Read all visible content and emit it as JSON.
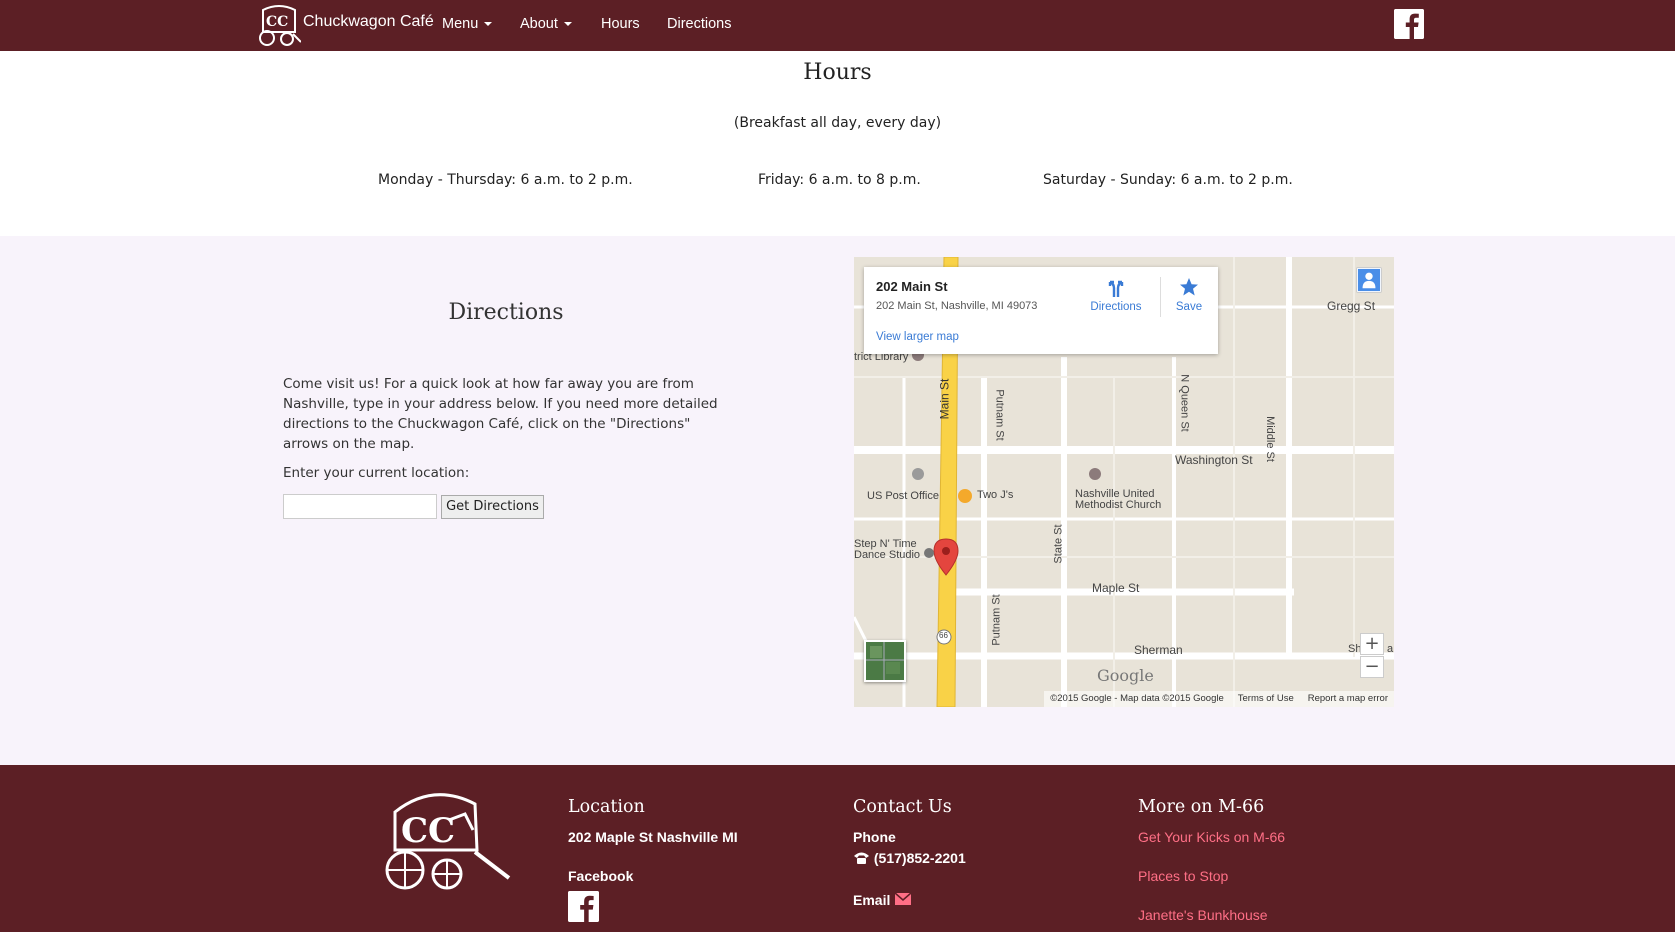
{
  "navbar": {
    "brand": "Chuckwagon Café",
    "items": [
      {
        "label": "Menu",
        "dropdown": true
      },
      {
        "label": "About",
        "dropdown": true
      },
      {
        "label": "Hours",
        "dropdown": false
      },
      {
        "label": "Directions",
        "dropdown": false
      }
    ],
    "colors": {
      "background": "#5c1f25",
      "text": "#ffffff"
    }
  },
  "hours": {
    "title": "Hours",
    "subtitle": "(Breakfast all day, every day)",
    "schedule": [
      "Monday - Thursday: 6 a.m. to 2 p.m.",
      "Friday: 6 a.m. to 8 p.m.",
      "Saturday - Sunday: 6 a.m. to 2 p.m."
    ]
  },
  "directions": {
    "title": "Directions",
    "intro": "Come visit us! For a quick look at how far away you are from Nashville, type in your address below. If you need more detailed directions to the Chuckwagon Café, click on the \"Directions\" arrows on the map.",
    "input_label": "Enter your current location:",
    "input_value": "",
    "button_label": "Get Directions",
    "background": "#f8f3fb"
  },
  "map": {
    "card": {
      "title": "202 Main St",
      "address": "202 Main St, Nashville, MI 49073",
      "larger_map": "View larger map",
      "directions": "Directions",
      "save": "Save"
    },
    "labels": {
      "gregg": "Gregg St",
      "library": "trict Library",
      "main": "Main St",
      "putnam_top": "Putnam St",
      "queen": "N Queen St",
      "middle": "Middle St",
      "washington": "Washington St",
      "post_office": "US Post Office",
      "two_js": "Two J's",
      "church1": "Nashville United",
      "church2": "Methodist Church",
      "step1": "Step N' Time",
      "step2": "Dance Studio",
      "state": "State St",
      "maple": "Maple St",
      "putnam_bottom": "Putnam St",
      "sherman": "Sherman",
      "sh_right": "Sh",
      "a_right": "a",
      "route": "66"
    },
    "google": "Google",
    "zoom_in": "+",
    "zoom_out": "−",
    "footer": {
      "copyright": "©2015 Google - Map data ©2015 Google",
      "terms": "Terms of Use",
      "report": "Report a map error"
    }
  },
  "footer": {
    "location": {
      "heading": "Location",
      "address": "202 Maple St Nashville MI",
      "facebook": "Facebook"
    },
    "contact": {
      "heading": "Contact Us",
      "phone_label": "Phone",
      "phone": "(517)852-2201",
      "email_label": "Email"
    },
    "more": {
      "heading": "More on M-66",
      "links": [
        "Get Your Kicks on M-66",
        "Places to Stop",
        "Janette's Bunkhouse"
      ]
    },
    "colors": {
      "background": "#5c1f25",
      "link": "#ff6f86"
    }
  }
}
